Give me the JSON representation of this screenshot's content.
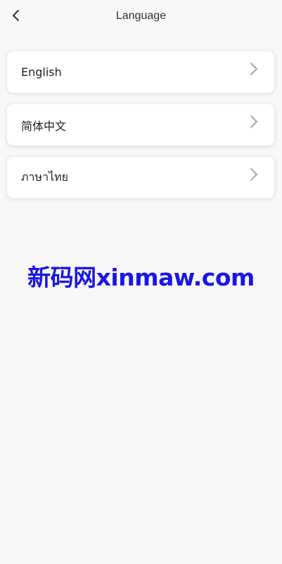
{
  "header": {
    "title": "Language"
  },
  "languages": [
    {
      "label": "English"
    },
    {
      "label": "简体中文"
    },
    {
      "label": "ภาษาไทย"
    }
  ],
  "watermark": {
    "text": "新码网xinmaw.com"
  },
  "colors": {
    "background": "#f8f8f8",
    "card": "#ffffff",
    "watermark": "#1a16e6"
  },
  "icons": {
    "back": "chevron-left-icon",
    "row_arrow": "chevron-right-icon"
  }
}
